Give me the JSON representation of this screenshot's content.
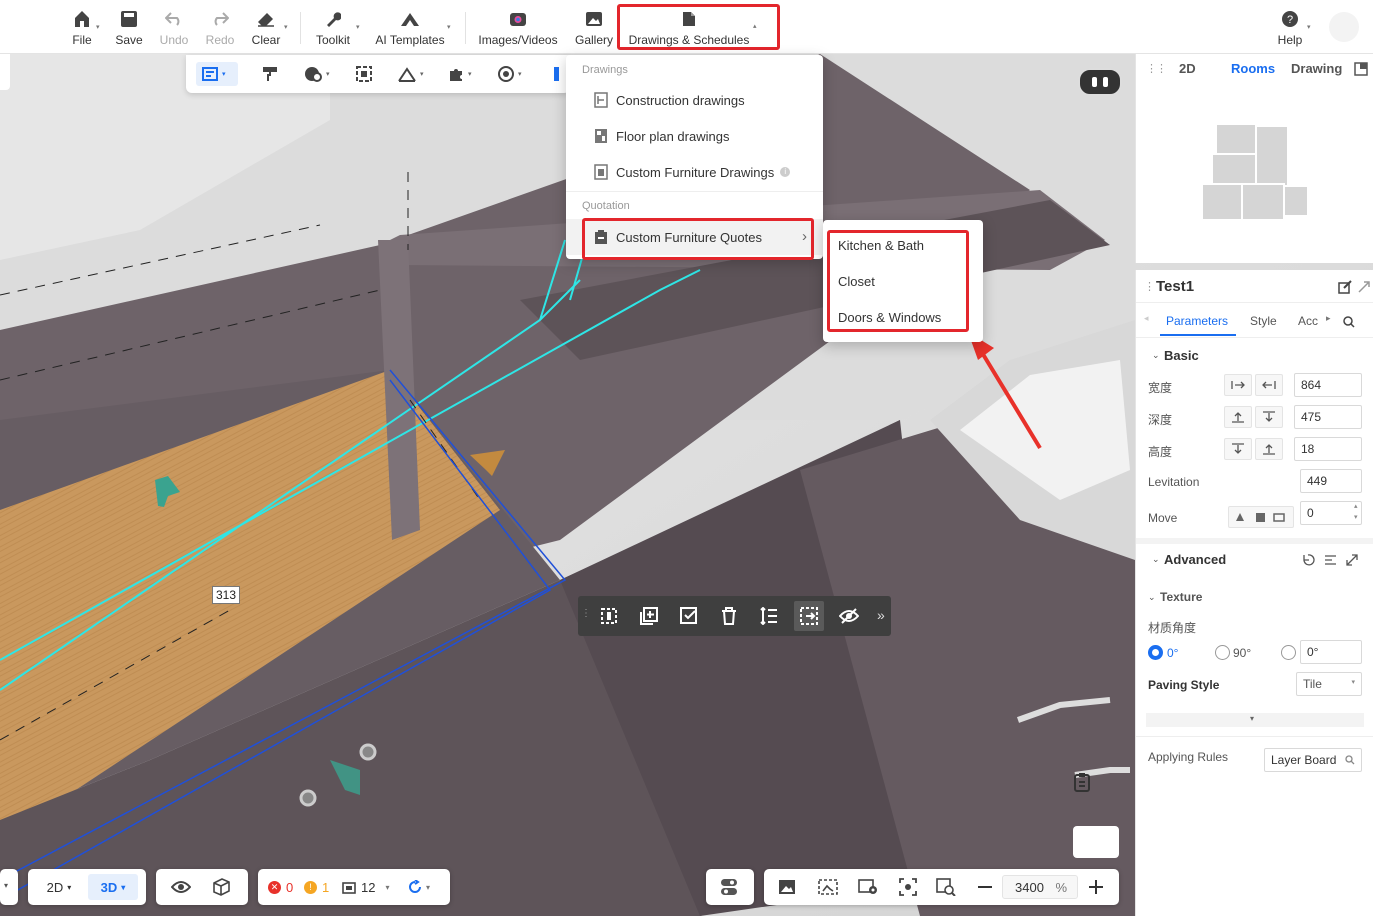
{
  "toolbar": {
    "file": "File",
    "save": "Save",
    "undo": "Undo",
    "redo": "Redo",
    "clear": "Clear",
    "toolkit": "Toolkit",
    "ai_templates": "AI Templates",
    "images_videos": "Images/Videos",
    "gallery": "Gallery",
    "drawings_schedules": "Drawings & Schedules",
    "help": "Help"
  },
  "dropdown": {
    "group_drawings": "Drawings",
    "construction": "Construction drawings",
    "floor_plan": "Floor plan drawings",
    "custom_furniture_drawings": "Custom Furniture Drawings",
    "group_quotation": "Quotation",
    "custom_furniture_quotes": "Custom Furniture Quotes"
  },
  "submenu": {
    "kitchen_bath": "Kitchen & Bath",
    "closet": "Closet",
    "doors_windows": "Doors & Windows"
  },
  "minimap": {
    "tab_2d": "2D",
    "tab_rooms": "Rooms",
    "tab_drawing": "Drawing"
  },
  "props": {
    "title": "Test1",
    "tab_parameters": "Parameters",
    "tab_style": "Style",
    "tab_acc": "Acc",
    "basic": "Basic",
    "width_label": "宽度",
    "width_value": "864",
    "depth_label": "深度",
    "depth_value": "475",
    "height_label": "高度",
    "height_value": "18",
    "levitation_label": "Levitation",
    "levitation_value": "449",
    "move_label": "Move",
    "move_value": "0",
    "advanced": "Advanced",
    "texture": "Texture",
    "angle_label": "材质角度",
    "angle_0": "0°",
    "angle_90": "90°",
    "angle_custom": "0°",
    "paving_style_label": "Paving Style",
    "paving_style_value": "Tile",
    "applying_rules_label": "Applying Rules",
    "applying_rules_value": "Layer Board"
  },
  "scene": {
    "dimension_label": "313"
  },
  "bottom": {
    "view_2d": "2D",
    "view_3d": "3D",
    "errors": "0",
    "warnings": "1",
    "items": "12",
    "zoom": "3400",
    "zoom_unit": "%"
  },
  "colors": {
    "accent": "#1a6ef0",
    "highlight": "#e3262c",
    "cabinet": "#6a6068",
    "wood": "#c8955a",
    "cyan_line": "#2ee6e6"
  }
}
